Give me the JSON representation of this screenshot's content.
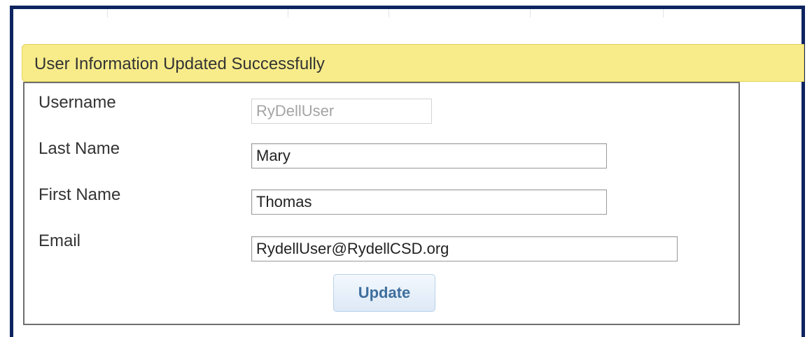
{
  "banner": {
    "message": "User Information Updated Successfully"
  },
  "form": {
    "username": {
      "label": "Username",
      "value": "RyDellUser"
    },
    "last_name": {
      "label": "Last Name",
      "value": "Mary"
    },
    "first_name": {
      "label": "First Name",
      "value": "Thomas"
    },
    "email": {
      "label": "Email",
      "value": "RydellUser@RydellCSD.org"
    },
    "update_label": "Update"
  },
  "colors": {
    "frame_border": "#0e2460",
    "banner_bg": "#f8ec8a",
    "button_text": "#3f6f9e"
  }
}
